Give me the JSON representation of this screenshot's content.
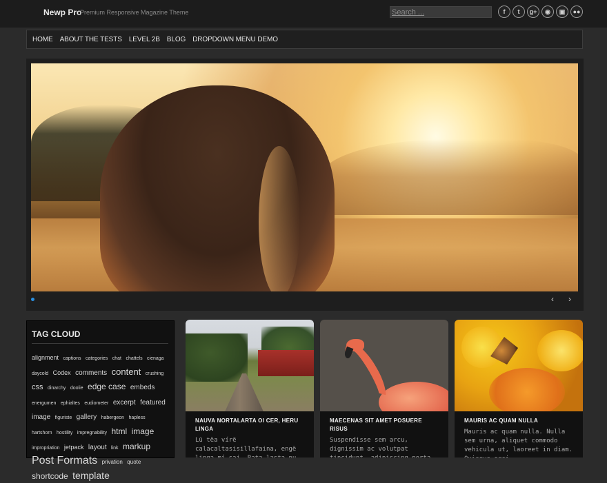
{
  "header": {
    "site_title": "Newp Pro",
    "site_desc": "Premium Responsive Magazine Theme",
    "search_placeholder": "Search ...",
    "socials": [
      "facebook-icon",
      "twitter-icon",
      "googleplus-icon",
      "rss-icon",
      "instagram-icon",
      "flickr-icon"
    ],
    "social_glyphs": [
      "f",
      "t",
      "g+",
      "◉",
      "▣",
      "●●"
    ]
  },
  "nav": {
    "items": [
      "HOME",
      "ABOUT THE TESTS",
      "LEVEL 2B",
      "BLOG",
      "DROPDOWN MENU DEMO"
    ]
  },
  "slider": {
    "prev": "‹",
    "next": "›",
    "active_color": "#2a8fe0"
  },
  "tagcloud": {
    "title": "TAG CLOUD",
    "tags": [
      {
        "t": "alignment",
        "s": 9
      },
      {
        "t": "captions",
        "s": 7
      },
      {
        "t": "categories",
        "s": 7
      },
      {
        "t": "chat",
        "s": 7
      },
      {
        "t": "chattels",
        "s": 7
      },
      {
        "t": "cienaga",
        "s": 7
      },
      {
        "t": "daycold",
        "s": 7
      },
      {
        "t": "Codex",
        "s": 9
      },
      {
        "t": "comments",
        "s": 10
      },
      {
        "t": "content",
        "s": 13
      },
      {
        "t": "crushing",
        "s": 7
      },
      {
        "t": "css",
        "s": 11
      },
      {
        "t": "dinarchy",
        "s": 7
      },
      {
        "t": "doolie",
        "s": 7
      },
      {
        "t": "edge case",
        "s": 12
      },
      {
        "t": "embeds",
        "s": 10
      },
      {
        "t": "energumen",
        "s": 7
      },
      {
        "t": "ephialtes",
        "s": 7
      },
      {
        "t": "eudiometer",
        "s": 7
      },
      {
        "t": "excerpt",
        "s": 10
      },
      {
        "t": "featured image",
        "s": 10
      },
      {
        "t": "figuriste",
        "s": 7
      },
      {
        "t": "gallery",
        "s": 10
      },
      {
        "t": "habergeon",
        "s": 7
      },
      {
        "t": "hapless",
        "s": 7
      },
      {
        "t": "hartshorn",
        "s": 7
      },
      {
        "t": "hostility",
        "s": 7
      },
      {
        "t": "impregnability",
        "s": 7
      },
      {
        "t": "html",
        "s": 12
      },
      {
        "t": "image",
        "s": 12
      },
      {
        "t": "impropriation",
        "s": 7
      },
      {
        "t": "jetpack",
        "s": 9
      },
      {
        "t": "layout",
        "s": 10
      },
      {
        "t": "link",
        "s": 7
      },
      {
        "t": "markup",
        "s": 12
      },
      {
        "t": "Post Formats",
        "s": 16
      },
      {
        "t": "privation",
        "s": 8
      },
      {
        "t": "quote",
        "s": 8
      },
      {
        "t": "shortcode",
        "s": 12
      },
      {
        "t": "template",
        "s": 14
      }
    ]
  },
  "cards": [
    {
      "title": "NAUVA NORTALARTA OI CER, HERU LINGA",
      "excerpt": "Lü tëa vírë calacaltasisillafaina, engë linga mí sai. Rata lasta nu cëa, en",
      "image": "railway"
    },
    {
      "title": "MAECENAS SIT AMET POSUERE RISUS",
      "excerpt": "Suspendisse sem arcu, dignissim ac volutpat tincidunt, adipiscing porta",
      "image": "flamingo"
    },
    {
      "title": "MAURIS AC QUAM NULLA",
      "excerpt": "Mauris ac quam nulla. Nulla sem urna, aliquet commodo vehicula ut, laoreet in diam. Quisque orci",
      "image": "butterfly-flowers"
    }
  ]
}
